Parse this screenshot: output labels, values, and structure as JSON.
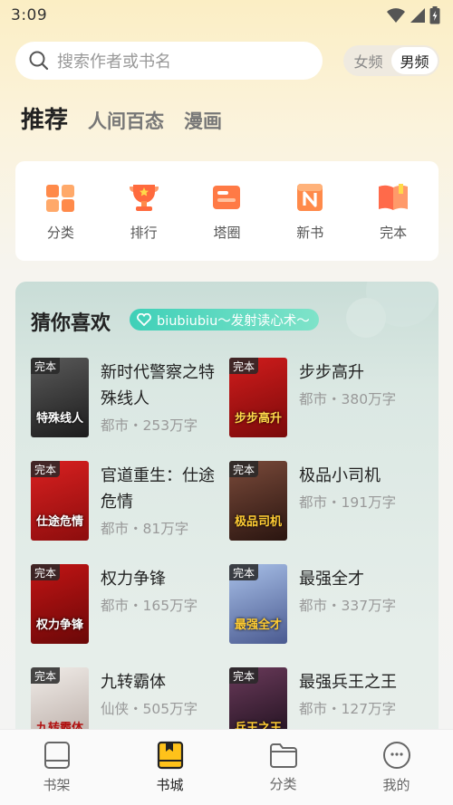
{
  "status": {
    "time": "3:09"
  },
  "search": {
    "placeholder": "搜索作者或书名"
  },
  "gender": {
    "female": "女频",
    "male": "男频"
  },
  "tabs": [
    {
      "label": "推荐",
      "active": true
    },
    {
      "label": "人间百态",
      "active": false
    },
    {
      "label": "漫画",
      "active": false
    }
  ],
  "quick": [
    {
      "label": "分类",
      "icon": "grid-icon"
    },
    {
      "label": "排行",
      "icon": "trophy-icon"
    },
    {
      "label": "塔圈",
      "icon": "card-icon"
    },
    {
      "label": "新书",
      "icon": "new-book-icon"
    },
    {
      "label": "完本",
      "icon": "open-book-icon"
    }
  ],
  "guess": {
    "title": "猜你喜欢",
    "slogan": "biubiubiu～发射读心术～",
    "badge": "完本",
    "books": [
      {
        "title": "新时代警察之特殊线人",
        "meta": "都市・253万字",
        "cover_text": "特殊线人",
        "cover_color": "#2a2a2a"
      },
      {
        "title": "步步高升",
        "meta": "都市・380万字",
        "cover_text": "步步高升",
        "cover_color": "#b31616"
      },
      {
        "title": "官道重生：仕途危情",
        "meta": "都市・81万字",
        "cover_text": "仕途危情",
        "cover_color": "#c01818"
      },
      {
        "title": "极品小司机",
        "meta": "都市・191万字",
        "cover_text": "极品司机",
        "cover_color": "#5a3226"
      },
      {
        "title": "权力争锋",
        "meta": "都市・165万字",
        "cover_text": "权力争锋",
        "cover_color": "#a50f0f"
      },
      {
        "title": "最强全才",
        "meta": "都市・337万字",
        "cover_text": "最强全才",
        "cover_color": "#6a7fb0"
      },
      {
        "title": "九转霸体",
        "meta": "仙侠・505万字",
        "cover_text": "九转霸体",
        "cover_color": "#d9d4cf"
      },
      {
        "title": "最强兵王之王",
        "meta": "都市・127万字",
        "cover_text": "兵王之王",
        "cover_color": "#3a2230"
      }
    ]
  },
  "nav": [
    {
      "label": "书架",
      "icon": "bookshelf-icon",
      "active": false
    },
    {
      "label": "书城",
      "icon": "bookstore-icon",
      "active": true
    },
    {
      "label": "分类",
      "icon": "folder-icon",
      "active": false
    },
    {
      "label": "我的",
      "icon": "profile-icon",
      "active": false
    }
  ]
}
